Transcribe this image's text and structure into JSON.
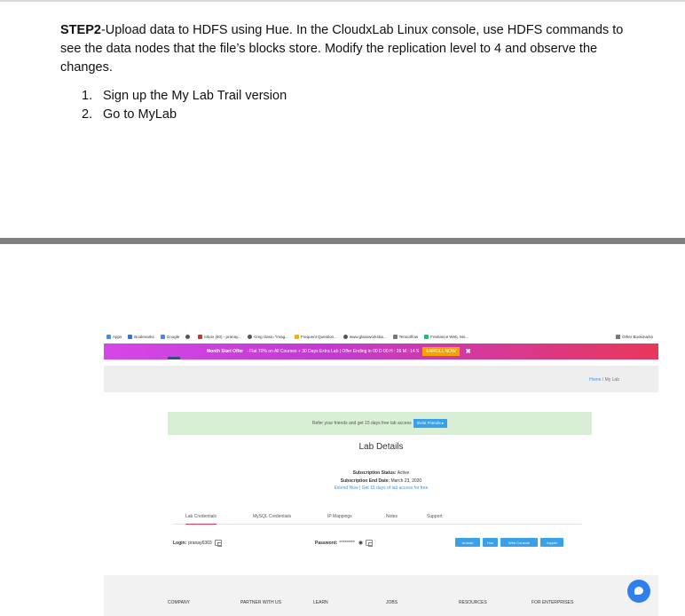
{
  "document": {
    "step_label": "STEP2",
    "step_text": "-Upload data to HDFS using Hue. In the CloudxLab Linux console, use HDFS commands to see the data nodes that the file’s blocks store. Modify the replication level to 4 and observe the changes.",
    "steps": [
      {
        "num": "1.",
        "text": "Sign up the My Lab Trail version"
      },
      {
        "num": "2.",
        "text": "Go to MyLab"
      }
    ]
  },
  "browser": {
    "bookmarks": [
      "Apps",
      "Bookmarks",
      "Google",
      "",
      "Inbox (60) - pranay...",
      "<img class=\"imag...",
      "Frequent Question...",
      "www.glassworksba...",
      "Tensorflow",
      "Freelance Web, Mo..."
    ],
    "other_bookmarks": "Other Bookmarks"
  },
  "promo": {
    "bold": "Month Start Offer",
    "text": "- Flat 70% on All Courses + 30 Days Extra Lab | Offer Ending in 00 D 00 H : 26 M : 14 S",
    "enroll": "ENROLL NOW",
    "close": "✖"
  },
  "breadcrumb": {
    "home": "Home",
    "sep": " / ",
    "current": "My Lab"
  },
  "refer": {
    "text": "Refer your friends and get 15 days free lab access",
    "button": "Invite Friends ▸"
  },
  "lab": {
    "title": "Lab Details",
    "status_label": "Subscription Status:",
    "status_value": "Active",
    "end_label": "Subscription End Date:",
    "end_value": "March 23, 2020",
    "extend": "Extend Now",
    "divider": " | ",
    "free": "Get 15 days of lab access for free"
  },
  "tabs": [
    "Lab Credentials",
    "MySQL Credentials",
    "IP Mappings",
    "Notes",
    "Support"
  ],
  "credentials": {
    "login_label": "Login:",
    "login_value": "pranay6303",
    "password_label": "Password:",
    "password_value": "*********"
  },
  "services": [
    "Ambari",
    "Hue",
    "Web Console",
    "Jupyter"
  ],
  "footer": [
    "COMPANY",
    "PARTNER WITH US",
    "LEARN",
    "JOBS",
    "RESOURCES",
    "FOR ENTERPRISES"
  ],
  "colors": {
    "promo_start": "#d547e7",
    "promo_end": "#e8385a",
    "enroll": "#f5a300",
    "button_blue": "#3aa0e8",
    "chat": "#2f80ed"
  }
}
